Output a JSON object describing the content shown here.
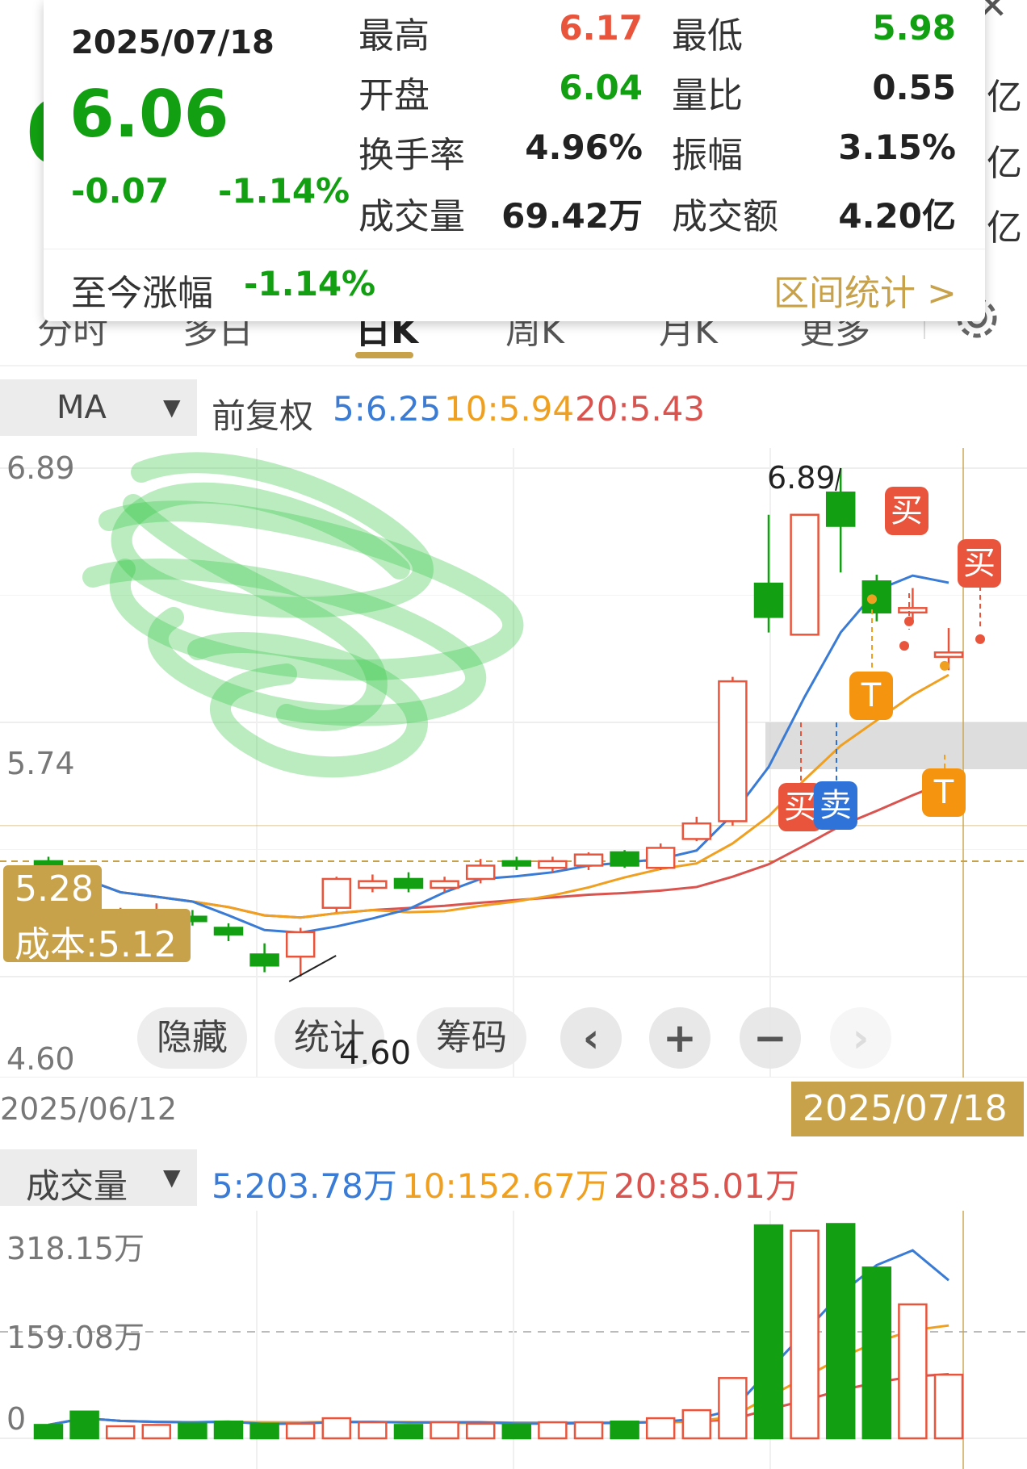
{
  "background": {
    "price_fragment": "6",
    "yi_labels": [
      "亿",
      "亿",
      "亿"
    ]
  },
  "popup": {
    "date": "2025/07/18",
    "price": "6.06",
    "change": "-0.07",
    "change_pct": "-1.14%",
    "stats": [
      {
        "label": "最高",
        "value": "6.17",
        "color": "#e8553c"
      },
      {
        "label": "最低",
        "value": "5.98",
        "color": "#12a012"
      },
      {
        "label": "开盘",
        "value": "6.04",
        "color": "#12a012"
      },
      {
        "label": "量比",
        "value": "0.55",
        "color": "#222222"
      },
      {
        "label": "换手率",
        "value": "4.96%",
        "color": "#222222"
      },
      {
        "label": "振幅",
        "value": "3.15%",
        "color": "#222222"
      },
      {
        "label": "成交量",
        "value": "69.42万",
        "color": "#222222"
      },
      {
        "label": "成交额",
        "value": "4.20亿",
        "color": "#222222"
      }
    ],
    "since_label": "至今涨幅",
    "since_value": "-1.14%",
    "interval_link": "区间统计 >"
  },
  "tabs": [
    "分时",
    "多日",
    "日K",
    "周K",
    "月K",
    "更多"
  ],
  "active_tab": "日K",
  "ma": {
    "select": "MA",
    "adjust": "前复权",
    "ma5": "5:6.25",
    "ma10": "10:5.94",
    "ma20": "20:5.43"
  },
  "price_axis": {
    "top": "6.89",
    "mid": "5.74",
    "bottom": "4.60"
  },
  "high_label": "6.89",
  "low_label": "4.60",
  "current_price_tag": "5.28",
  "cost_tag": "成本:5.12",
  "start_date": "2025/06/12",
  "end_date": "2025/07/18",
  "markers": {
    "buy": "买",
    "sell": "卖",
    "t": "T"
  },
  "controls": {
    "hide": "隐藏",
    "stats": "统计",
    "chips": "筹码"
  },
  "volume": {
    "select": "成交量",
    "ma5": "5:203.78万",
    "ma10": "10:152.67万",
    "ma20": "20:85.01万",
    "axis_top": "318.15万",
    "axis_mid": "159.08万",
    "axis_bottom": "0"
  },
  "colors": {
    "up": "#e8553c",
    "down": "#12a012",
    "ma5": "#3a7bd5",
    "ma10": "#f0a020",
    "ma20": "#d9534f",
    "cost": "#c8a24a"
  },
  "chart_data": {
    "type": "candlestick",
    "start": "2025/06/12",
    "end": "2025/07/18",
    "ylim": [
      4.6,
      6.89
    ],
    "candles": [
      {
        "o": 5.12,
        "c": 5.1,
        "h": 5.14,
        "l": 5.07
      },
      {
        "o": 5.09,
        "c": 4.98,
        "h": 5.09,
        "l": 4.96
      },
      {
        "o": 4.84,
        "c": 4.86,
        "h": 4.91,
        "l": 4.8
      },
      {
        "o": 4.88,
        "c": 4.9,
        "h": 4.93,
        "l": 4.86
      },
      {
        "o": 4.87,
        "c": 4.85,
        "h": 4.9,
        "l": 4.83
      },
      {
        "o": 4.82,
        "c": 4.79,
        "h": 4.84,
        "l": 4.76
      },
      {
        "o": 4.7,
        "c": 4.65,
        "h": 4.75,
        "l": 4.62
      },
      {
        "o": 4.69,
        "c": 4.8,
        "h": 4.82,
        "l": 4.6
      },
      {
        "o": 4.91,
        "c": 5.04,
        "h": 5.05,
        "l": 4.89
      },
      {
        "o": 5.0,
        "c": 5.03,
        "h": 5.06,
        "l": 4.98
      },
      {
        "o": 5.04,
        "c": 5.0,
        "h": 5.07,
        "l": 4.98
      },
      {
        "o": 5.0,
        "c": 5.03,
        "h": 5.05,
        "l": 4.98
      },
      {
        "o": 5.04,
        "c": 5.1,
        "h": 5.13,
        "l": 5.02
      },
      {
        "o": 5.12,
        "c": 5.1,
        "h": 5.14,
        "l": 5.08
      },
      {
        "o": 5.09,
        "c": 5.12,
        "h": 5.14,
        "l": 5.07
      },
      {
        "o": 5.1,
        "c": 5.15,
        "h": 5.16,
        "l": 5.08
      },
      {
        "o": 5.16,
        "c": 5.1,
        "h": 5.17,
        "l": 5.09
      },
      {
        "o": 5.09,
        "c": 5.18,
        "h": 5.2,
        "l": 5.08
      },
      {
        "o": 5.22,
        "c": 5.29,
        "h": 5.32,
        "l": 5.21
      },
      {
        "o": 5.3,
        "c": 5.93,
        "h": 5.95,
        "l": 5.28
      },
      {
        "o": 6.37,
        "c": 6.22,
        "h": 6.68,
        "l": 6.15
      },
      {
        "o": 6.14,
        "c": 6.68,
        "h": 6.68,
        "l": 6.14
      },
      {
        "o": 6.78,
        "c": 6.63,
        "h": 6.89,
        "l": 6.42
      },
      {
        "o": 6.38,
        "c": 6.24,
        "h": 6.41,
        "l": 6.2
      },
      {
        "o": 6.24,
        "c": 6.26,
        "h": 6.35,
        "l": 6.2
      },
      {
        "o": 6.04,
        "c": 6.06,
        "h": 6.17,
        "l": 5.98
      }
    ],
    "volume": [
      20,
      40,
      18,
      20,
      22,
      25,
      22,
      22,
      30,
      24,
      20,
      24,
      22,
      20,
      24,
      24,
      25,
      30,
      42,
      90,
      318,
      310,
      320,
      255,
      200,
      95
    ],
    "volume_ylim": [
      0,
      318.15
    ]
  }
}
